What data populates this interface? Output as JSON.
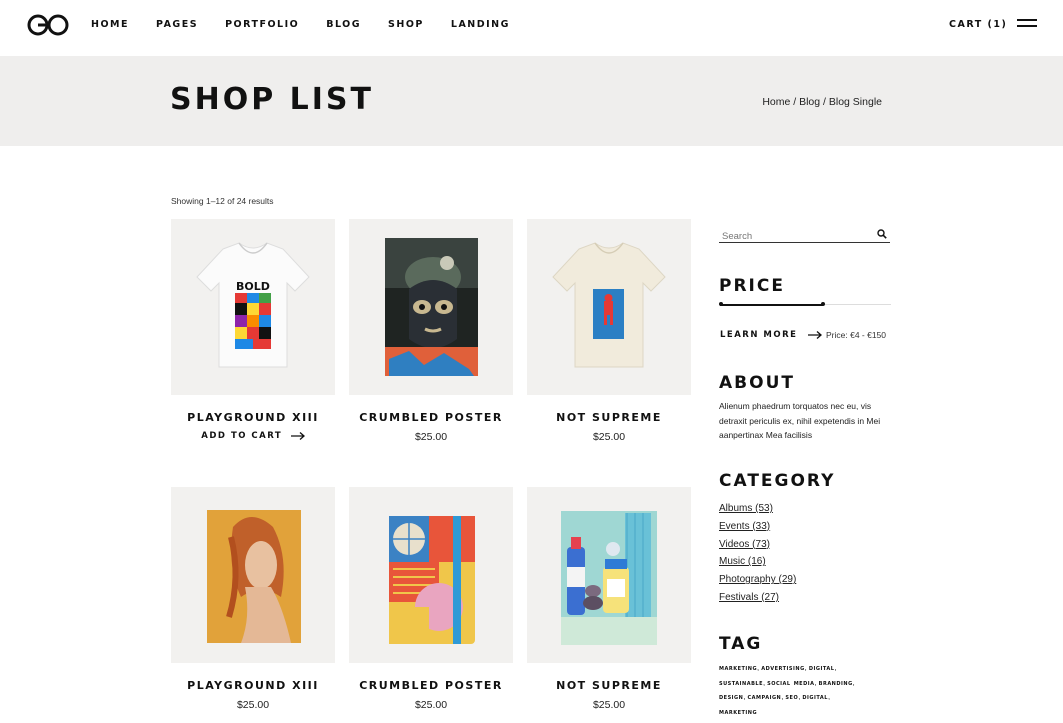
{
  "header": {
    "nav": [
      "HOME",
      "PAGES",
      "PORTFOLIO",
      "BLOG",
      "SHOP",
      "LANDING"
    ],
    "cart_label": "CART (1)"
  },
  "page": {
    "title": "SHOP LIST",
    "breadcrumb": [
      "Home",
      "Blog",
      "Blog Single"
    ],
    "results_text": "Showing 1–12 of 24 results"
  },
  "products": [
    {
      "name": "PLAYGROUND XIII",
      "price": "",
      "action": "ADD TO CART",
      "image": "tshirt-bold"
    },
    {
      "name": "CRUMBLED POSTER",
      "price": "$25.00",
      "image": "poster-mask"
    },
    {
      "name": "NOT SUPREME",
      "price": "$25.00",
      "image": "tshirt-cream"
    },
    {
      "name": "PLAYGROUND XIII",
      "price": "$25.00",
      "image": "poster-portrait"
    },
    {
      "name": "CRUMBLED POSTER",
      "price": "$25.00",
      "image": "notebook"
    },
    {
      "name": "NOT SUPREME",
      "price": "$25.00",
      "image": "bottles"
    }
  ],
  "sidebar": {
    "search_placeholder": "Search",
    "price": {
      "heading": "PRICE",
      "learn_more": "LEARN MORE",
      "range_text": "Price: €4 - €150",
      "min_fraction": 0.0,
      "max_fraction": 0.6
    },
    "about": {
      "heading": "ABOUT",
      "text": "Alienum phaedrum torquatos nec eu, vis detraxit periculis ex, nihil expetendis in Mei aanpertinax Mea facilisis"
    },
    "category": {
      "heading": "CATEGORY",
      "items": [
        "Albums (53)",
        "Events  (33)",
        "Videos (73)",
        "Music (16)",
        "Photography (29)",
        "Festivals (27)"
      ]
    },
    "tag": {
      "heading": "TAG",
      "items": [
        "marketing",
        "advertising",
        "digital",
        "sustainable",
        "social media",
        "branding",
        "design",
        "campaign",
        "seo",
        "digital",
        "marketing"
      ]
    }
  },
  "colors": {
    "band": "#efeeed",
    "thumb_bg": "#f2f1ef",
    "text": "#111111"
  }
}
